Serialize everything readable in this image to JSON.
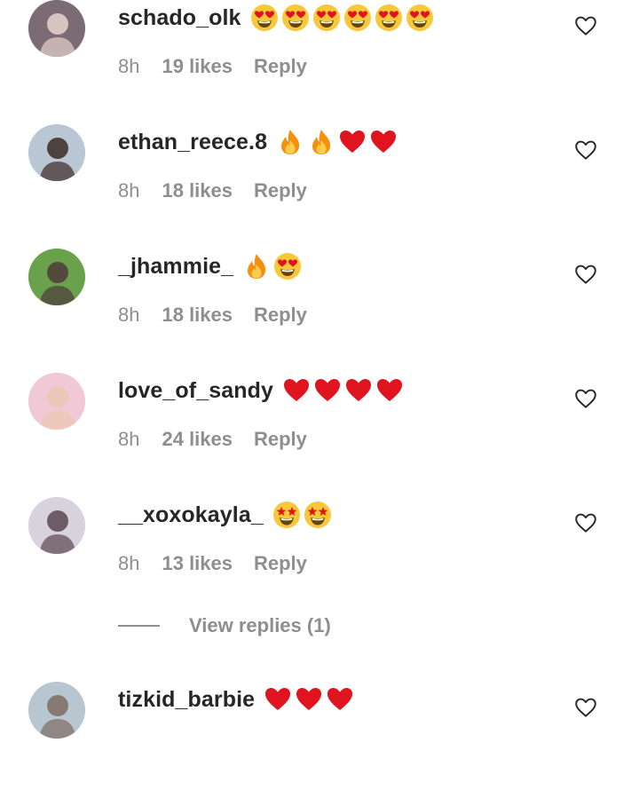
{
  "comments": [
    {
      "username": "schado_olk",
      "emojis": [
        "heart-eyes",
        "heart-eyes",
        "heart-eyes",
        "heart-eyes",
        "heart-eyes",
        "heart-eyes"
      ],
      "time": "8h",
      "likes": "19 likes",
      "reply": "Reply",
      "avatar_colors": [
        "#7a6b74",
        "#e7d2cc"
      ]
    },
    {
      "username": "ethan_reece.8",
      "emojis": [
        "fire",
        "fire",
        "red-heart",
        "red-heart"
      ],
      "time": "8h",
      "likes": "18 likes",
      "reply": "Reply",
      "avatar_colors": [
        "#b9c6d4",
        "#3a2a25"
      ]
    },
    {
      "username": "_jhammie_",
      "emojis": [
        "fire",
        "heart-eyes"
      ],
      "time": "8h",
      "likes": "18 likes",
      "reply": "Reply",
      "avatar_colors": [
        "#6aa24c",
        "#4f3a3a"
      ]
    },
    {
      "username": "love_of_sandy",
      "emojis": [
        "red-heart",
        "red-heart",
        "red-heart",
        "red-heart"
      ],
      "time": "8h",
      "likes": "24 likes",
      "reply": "Reply",
      "avatar_colors": [
        "#f1c9d6",
        "#e9c7b2"
      ]
    },
    {
      "username": "__xoxokayla_",
      "emojis": [
        "star-struck",
        "star-struck"
      ],
      "time": "8h",
      "likes": "13 likes",
      "reply": "Reply",
      "avatar_colors": [
        "#d7d2dc",
        "#5b4650"
      ]
    },
    {
      "username": "tizkid_barbie",
      "emojis": [
        "red-heart",
        "red-heart",
        "red-heart"
      ],
      "time": "",
      "likes": "",
      "reply": "",
      "avatar_colors": [
        "#b8c7cf",
        "#7c6c62"
      ]
    }
  ],
  "view_replies": {
    "label": "View replies (1)"
  },
  "colors": {
    "text": "#262626",
    "secondary": "#8e8e8e",
    "heart_red": "#e0141e",
    "emoji_yellow": "#f9c73a"
  },
  "icons": {
    "like": "heart-outline-icon"
  }
}
